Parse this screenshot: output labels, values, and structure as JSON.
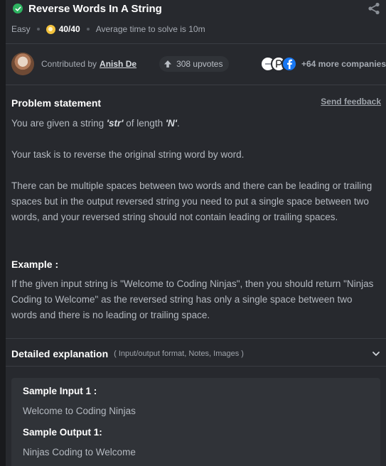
{
  "problem": {
    "title": "Reverse Words In A String",
    "difficulty": "Easy",
    "score": "40/40",
    "avg_time": "Average time to solve is 10m"
  },
  "contributor": {
    "label": "Contributed by",
    "name": "Anish De",
    "upvotes": "308 upvotes",
    "more_companies": "+64 more companies"
  },
  "statement": {
    "heading": "Problem statement",
    "feedback_link": "Send feedback",
    "p1_prefix": "You are given a string ",
    "p1_str": "'str'",
    "p1_middle": " of length ",
    "p1_n": "'N'",
    "p1_suffix": ".",
    "p2": "Your task is to reverse the original string word by word.",
    "p3": "There can be multiple spaces between two words and there can be leading or trailing spaces but in the output reversed string you need to put a single space between two words, and your reversed string should not contain leading or trailing spaces.",
    "example_heading": "Example :",
    "example_text": "If the given input string is \"Welcome to Coding Ninjas\", then you should return \"Ninjas Coding to Welcome\" as the reversed string has only a single space between two words and there is no leading or trailing space."
  },
  "details": {
    "title": "Detailed explanation",
    "subtitle": "( Input/output format, Notes, Images )"
  },
  "samples": {
    "input_label": "Sample Input 1 :",
    "input_value": "Welcome to Coding Ninjas",
    "output_label": "Sample Output 1:",
    "output_value": "Ninjas Coding to Welcome"
  },
  "colors": {
    "background": "#27292e",
    "success": "#2eb361",
    "coin": "#f3c23c"
  }
}
